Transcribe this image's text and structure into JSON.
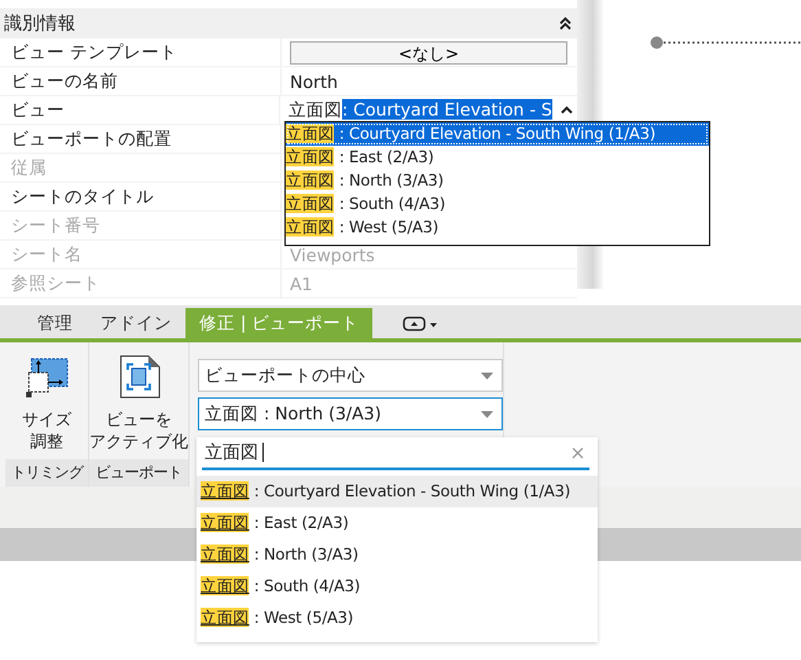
{
  "properties": {
    "section": {
      "title": "識別情報",
      "expanded": true
    },
    "rows": [
      {
        "label": "ビュー テンプレート",
        "kind": "button",
        "value": "<なし>",
        "disabled": false
      },
      {
        "label": "ビューの名前",
        "kind": "text",
        "value": "North",
        "disabled": false
      },
      {
        "label": "ビュー",
        "kind": "combo",
        "value": "立面図",
        "selected_text": ": Courtyard Elevation - S",
        "disabled": false
      },
      {
        "label": "ビューポートの配置",
        "kind": "text",
        "disabled": false
      },
      {
        "label": "従属",
        "kind": "text",
        "disabled": true
      },
      {
        "label": "シートのタイトル",
        "kind": "text",
        "disabled": false
      },
      {
        "label": "シート番号",
        "kind": "text",
        "disabled": true
      },
      {
        "label": "シート名",
        "kind": "text",
        "value": "Viewports",
        "disabled": true
      },
      {
        "label": "参照シート",
        "kind": "text",
        "value": "A1",
        "disabled": true
      }
    ],
    "view_list": [
      {
        "match": "立面図",
        "rest": ": Courtyard Elevation - South Wing (1/A3)",
        "selected": true
      },
      {
        "match": "立面図",
        "rest": ": East (2/A3)",
        "selected": false
      },
      {
        "match": "立面図",
        "rest": ": North (3/A3)",
        "selected": false
      },
      {
        "match": "立面図",
        "rest": ": South (4/A3)",
        "selected": false
      },
      {
        "match": "立面図",
        "rest": ": West (5/A3)",
        "selected": false
      }
    ]
  },
  "ribbon": {
    "tabs": [
      {
        "label": "管理",
        "selected": false
      },
      {
        "label": "アドイン",
        "selected": false
      },
      {
        "label": "修正 | ビューポート",
        "selected": true
      }
    ],
    "panels": [
      {
        "label": "トリミング",
        "tool": {
          "kind": "resize",
          "lines": [
            "サイズ",
            "調整"
          ]
        }
      },
      {
        "label": "ビューポート",
        "tool": {
          "kind": "activate",
          "lines": [
            "ビューを",
            "アクティブ化"
          ]
        }
      }
    ],
    "combos": [
      {
        "value": "ビューポートの中心",
        "focused": false
      },
      {
        "value": "立面図 : North (3/A3)",
        "focused": true
      }
    ],
    "popup": {
      "search": {
        "value": "立面図"
      },
      "items": [
        {
          "match": "立面図",
          "rest": ": Courtyard Elevation - South Wing (1/A3)",
          "highlighted": true
        },
        {
          "match": "立面図",
          "rest": ": East (2/A3)",
          "highlighted": false
        },
        {
          "match": "立面図",
          "rest": ": North (3/A3)",
          "highlighted": false
        },
        {
          "match": "立面図",
          "rest": ": South (4/A3)",
          "highlighted": false
        },
        {
          "match": "立面図",
          "rest": ": West (5/A3)",
          "highlighted": false
        }
      ]
    }
  }
}
